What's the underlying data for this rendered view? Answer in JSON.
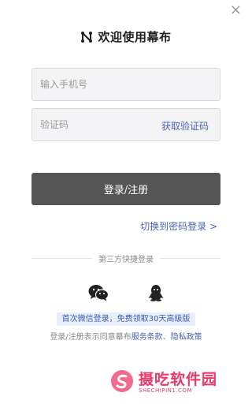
{
  "dialog": {
    "title": "欢迎使用幕布",
    "close_symbol": "×"
  },
  "form": {
    "phone_placeholder": "输入手机号",
    "code_placeholder": "验证码",
    "get_code_label": "获取验证码",
    "login_label": "登录/注册",
    "switch_label": "切换到密码登录 >"
  },
  "third_party": {
    "divider_label": "第三方快捷登录",
    "icons": [
      "wechat-icon",
      "qq-icon"
    ]
  },
  "promo": {
    "text": "首次微信登录，免费领取30天高级版"
  },
  "agreement": {
    "prefix": "登录/注册表示同意幕布",
    "terms_label": "服务条款",
    "separator": "、",
    "privacy_label": "隐私政策"
  },
  "watermark": {
    "cn": "摄吃软件园",
    "en": "SHECHIPIN1.COM"
  },
  "colors": {
    "accent": "#4a63b7",
    "button": "#555555",
    "watermark": "#e8396a"
  }
}
